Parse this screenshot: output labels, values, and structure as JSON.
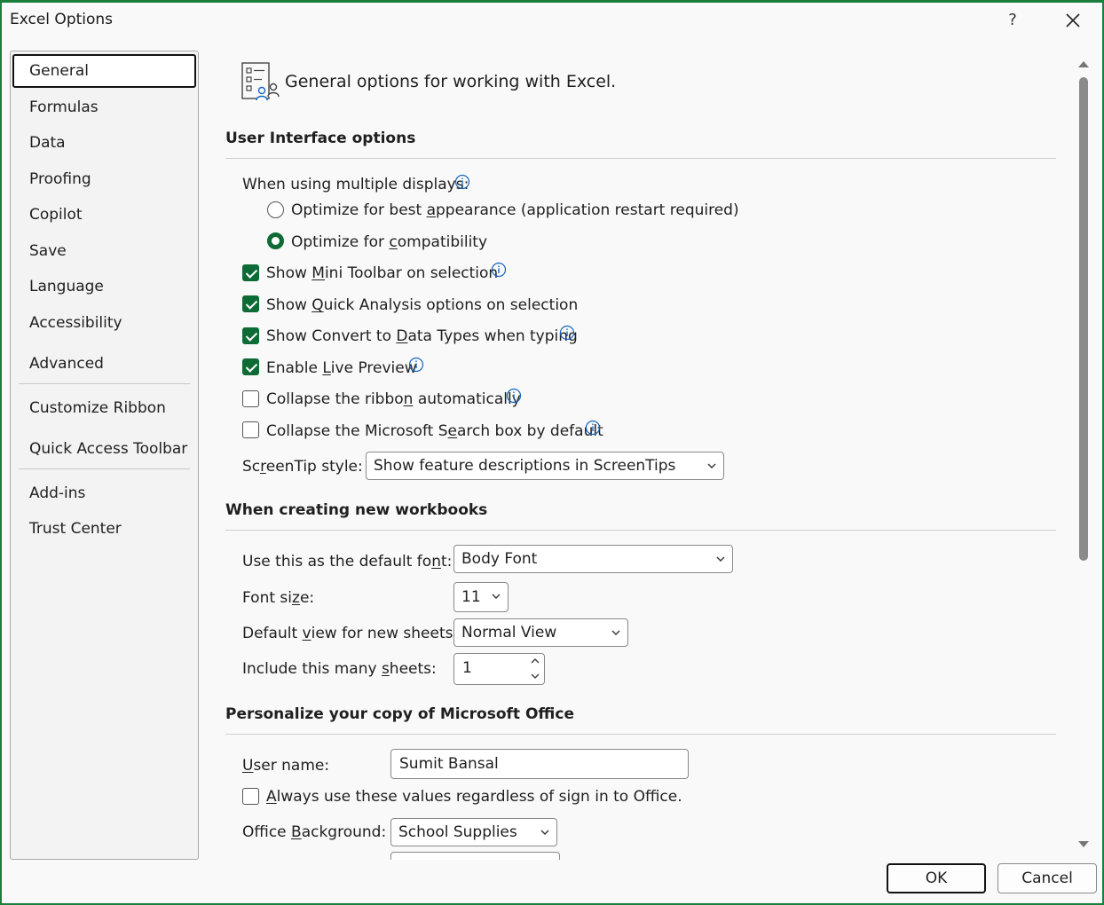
{
  "window": {
    "title": "Excel Options",
    "help": "?"
  },
  "nav": {
    "items": [
      "General",
      "Formulas",
      "Data",
      "Proofing",
      "Copilot",
      "Save",
      "Language",
      "Accessibility",
      "Advanced",
      "Customize Ribbon",
      "Quick Access Toolbar",
      "Add-ins",
      "Trust Center"
    ],
    "selected": "General"
  },
  "header": {
    "text": "General options for working with Excel."
  },
  "ui_options": {
    "title": "User Interface options",
    "multi_display_label": "When using multiple displays:",
    "radio_best_pre": "Optimize for best ",
    "radio_best_key": "a",
    "radio_best_post": "ppearance (application restart required)",
    "radio_compat_pre": "Optimize for ",
    "radio_compat_key": "c",
    "radio_compat_post": "ompatibility",
    "mini_pre": "Show ",
    "mini_key": "M",
    "mini_post": "ini Toolbar on selection",
    "quick_pre": "Show ",
    "quick_key": "Q",
    "quick_post": "uick Analysis options on selection",
    "convert_pre": "Show Convert to ",
    "convert_key": "D",
    "convert_post": "ata Types when typing",
    "live_pre": "Enable ",
    "live_key": "L",
    "live_post": "ive Preview",
    "ribbon_pre": "Collapse the ribbo",
    "ribbon_key": "n",
    "ribbon_post": " automatically",
    "search_pre": "Collapse the Microsoft S",
    "search_key": "e",
    "search_post": "arch box by default",
    "screentip_pre": "Sc",
    "screentip_key": "r",
    "screentip_post": "eenTip style:",
    "screentip_value": "Show feature descriptions in ScreenTips"
  },
  "new_workbooks": {
    "title": "When creating new workbooks",
    "font_pre": "Use this as the default fo",
    "font_key": "n",
    "font_post": "t:",
    "font_value": "Body Font",
    "size_pre": "Font si",
    "size_key": "z",
    "size_post": "e:",
    "size_value": "11",
    "view_pre": "Default ",
    "view_key": "v",
    "view_post": "iew for new sheets:",
    "view_value": "Normal View",
    "sheets_pre": "Include this many ",
    "sheets_key": "s",
    "sheets_post": "heets:",
    "sheets_value": "1"
  },
  "personalize": {
    "title": "Personalize your copy of Microsoft Office",
    "username_key": "U",
    "username_post": "ser name:",
    "username_value": "Sumit Bansal",
    "always_key": "A",
    "always_post": "lways use these values regardless of sign in to Office.",
    "background_pre": "Office ",
    "background_key": "B",
    "background_post": "ackground:",
    "background_value": "School Supplies"
  },
  "buttons": {
    "ok": "OK",
    "cancel": "Cancel"
  },
  "colors": {
    "accent": "#0f6b35",
    "frame": "#1a7f3c",
    "info": "#1565c0"
  }
}
